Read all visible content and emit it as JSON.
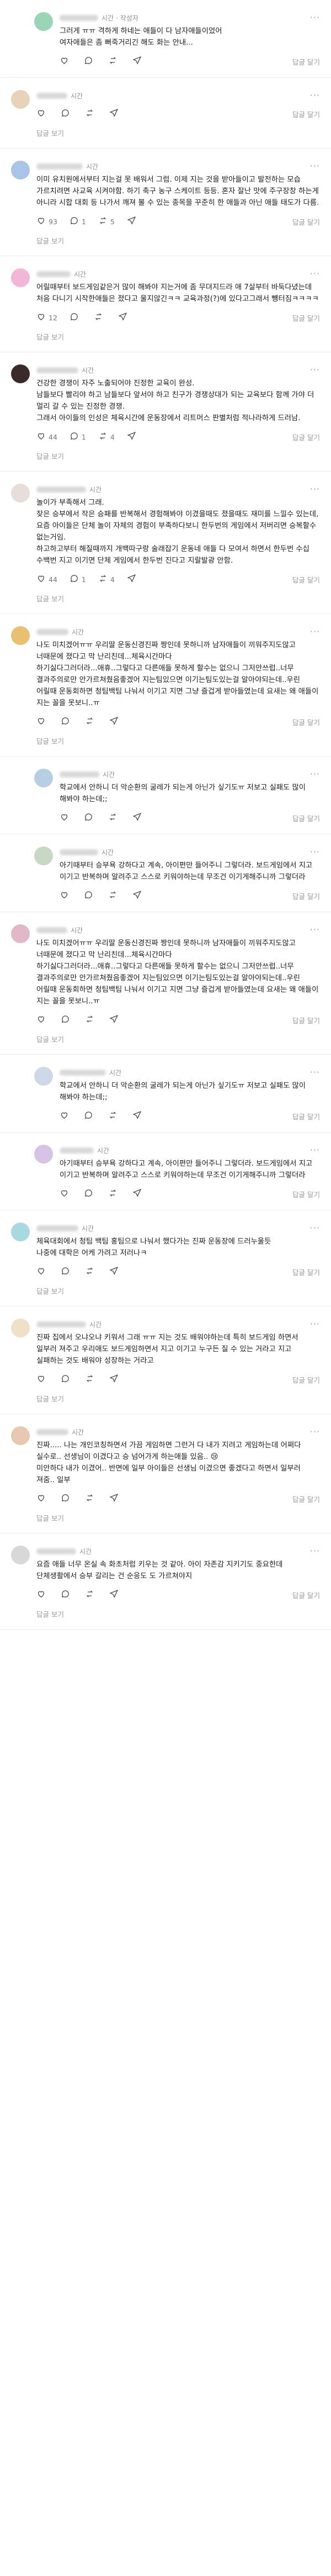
{
  "labels": {
    "view_replies": "답글 보기",
    "reply": "답글 달기",
    "author_badge": "작성자",
    "more": "···"
  },
  "colors": {
    "like_red": "#e5484d",
    "text": "#1b1b1b",
    "muted": "#8e8e8e"
  },
  "comments": [
    {
      "time": "시간",
      "author": true,
      "text": "그러게 ㅠㅠ 격하게 하네는 애들이 다 남자애들이었어\n여자애들은 좀 뻐죽거리긴 해도 화는 안내...",
      "likes": "",
      "views": "",
      "shares": "",
      "avatar": "#9bd5b8",
      "nested": true,
      "show_view": false
    },
    {
      "time": "시간",
      "author": false,
      "text": "",
      "likes": "",
      "views": "",
      "shares": "",
      "avatar": "#e7d3b8",
      "nested": false,
      "show_view": true,
      "short": true
    },
    {
      "time": "시간",
      "author": false,
      "text": "이미 유치원에서부터 지는걸 못 배워서 그럼. 이제 지는 것을 받아들이고 발전하는 모습 가르치려면 사교육 시켜야함. 하기 축구 농구 스케이트 등등. 혼자 잘난 맛에 주구장창 하는게 아니라 시합 대회 등 나가서 깨져 볼 수 있는 종목을 꾸준히 한 애들과 아닌 애들 태도가 다름.",
      "likes": "93",
      "views": "1",
      "shares": "5",
      "avatar": "#a9c4e6",
      "nested": false,
      "show_view": true
    },
    {
      "time": "시간",
      "author": false,
      "text": "어릴때부터 보드게임같은거 많이 해봐야 지는거에 좀 무뎌지드라 애 7살부터 바둑다녔는데 처음 다니기 시작한애들은 졌다고 울지않긴ㅋㅋ 교육과정(?)에 있다고그래서 뻉터짐ㅋㅋㅋㅋ",
      "likes": "12",
      "views": "",
      "shares": "",
      "avatar": "#f3b6d6",
      "nested": false,
      "show_view": true
    },
    {
      "time": "시간",
      "author": false,
      "text": "건강한 경쟁이 자주 노출되어야 진정한 교육이 완성.\n남들보다 빨리야 하고 남들보다 앞서야 하고 친구가 경쟁상대가 되는 교육보다 함께 가야 더 멀리 갈 수 있는 진정한 경쟁.\n그래서 아이들의 인성은 체육시간에 운동장에서 리트머스 판별처럼 적나라하게 드러남.",
      "likes": "44",
      "views": "1",
      "shares": "4",
      "avatar": "#3a2a2a",
      "nested": false,
      "show_view": true
    },
    {
      "time": "시간",
      "author": false,
      "text": "놀이가 부족해서 그래.\n잦은 승부에서 작은 승패를 반복해서 경험해봐야 이겼을때도 졌을때도 재미를 느낄수 있는데, 요즘 아이들은 단체 놀이 자체의 경험이 부족하다보니 한두번의 게임에서 저버리면 승복할수 없는거임.\n하고하고부터 해질때까지 개백따구랑 술래잡기 운동네 애들 다 모여서 하면서 한두번 수십 수백번 지고 이기면 단체 게임에서 한두번 진다고 지랄발광 안함.",
      "likes": "44",
      "views": "1",
      "shares": "4",
      "avatar": "#e8ddd8",
      "nested": false,
      "show_view": true
    },
    {
      "time": "시간",
      "author": false,
      "text": "나도 미치겠어ㅠㅠ 우리딸 운동신경진짜 짱인데 못하니까 남자애들이 끼워주지도않고 너때문에 졌다고 막 난리친데...체육시간마다\n하기싫다그러더라...애휴..그렇다고 다른애들 못하게 할수는 없으니 그저안쓰럽..너무 결과주의로만 안가르쳐줬음좋겠어 지는팀있으면 이기는팀도있는걸 알아야되는데..우린 어릴때 운동회하면 청팀백팀 나눠서 이기고 지면 그냥 즐겁게 받아들였는데 요새는 왜 애들이 지는 꼴을 못보니..ㅠ",
      "likes": "",
      "views": "",
      "shares": "",
      "avatar": "#e9c070",
      "nested": false,
      "show_view": true
    },
    {
      "time": "시간",
      "author": false,
      "text": "학교에서 안하니 더 악순환의 굴레가 되는게 아닌가 싶기도ㅠ 저보고 실패도 많이 해봐야 하는데;;",
      "likes": "",
      "views": "",
      "shares": "",
      "avatar": "#b7cfe3",
      "nested": true,
      "show_view": false
    },
    {
      "time": "시간",
      "author": false,
      "text": "아기때부터 승부욕 강하다고 계속, 아이편만 들어주니 그렇더라. 보드게임에서 지고 이기고 반복하며 알려주고 스스로 키워야하는데 무조건 이기게해주니까 그렇더라",
      "likes": "",
      "views": "",
      "shares": "",
      "avatar": "#c7d9c3",
      "nested": true,
      "show_view": false
    },
    {
      "time": "시간",
      "author": false,
      "text": "나도 미치겠어ㅠㅠ 우리딸 운동신경진짜 짱인데 못하니까 남자애들이 끼워주지도않고 너때문에 졌다고 막 난리친데...체육시간마다\n하기싫다그러더라...애휴..그렇다고 다른애들 못하게 할수는 없으니 그저안쓰럽..너무 결과주의로만 안가르쳐줬음좋겠어 지는팀있으면 이기는팀도있는걸 알아야되는데..우린 어릴때 운동회하면 청팀백팀 나눠서 이기고 지면 그냥 즐겁게 받아들였는데 요새는 왜 애들이 지는 꼴을 못보니..ㅠ",
      "likes": "",
      "views": "",
      "shares": "",
      "avatar": "#e0b8c8",
      "nested": false,
      "show_view": true
    },
    {
      "time": "시간",
      "author": false,
      "text": "학교에서 안하니 더 악순환의 굴레가 되는게 아닌가 싶기도ㅠ 저보고 실패도 많이 해봐야 하는데;;",
      "likes": "",
      "views": "",
      "shares": "",
      "avatar": "#cfd8e8",
      "nested": true,
      "show_view": false
    },
    {
      "time": "시간",
      "author": false,
      "text": "아기때부터 승부욕 강하다고 계속, 아이편만 들어주니 그렇더라. 보드게임에서 지고 이기고 반복하며 알려주고 스스로 키워야하는데 무조건 이기게해주니까 그렇더라",
      "likes": "",
      "views": "",
      "shares": "",
      "avatar": "#d7c3e6",
      "nested": true,
      "show_view": false
    },
    {
      "time": "시간",
      "author": false,
      "text": "체육대회에서 청팀 백팀 홍팀으로 나눠서 했다가는 진짜 운동장에 드러누울듯\n나중에 대학은 어케 가려고 저러나ㅋ",
      "likes": "",
      "views": "",
      "shares": "",
      "avatar": "#a8d8e0",
      "nested": false,
      "show_view": true
    },
    {
      "time": "시간",
      "author": false,
      "text": "진짜 집에서 오냐오냐 키워서 그래 ㅠㅠ 지는 것도 배워야하는데 특히 보드게임 하면서 일부러 져주고 우리애도 보드게임하면서 지고 이기고 누구든 질 수 있는 거라고 지고 실패하는 것도 배워야 성장하는 거라고",
      "likes": "",
      "views": "",
      "shares": "",
      "avatar": "#f0e0c8",
      "nested": false,
      "show_view": true
    },
    {
      "time": "시간",
      "author": false,
      "text": "진짜..... 나는 개인코칭하면서 가끔 게임하면 그런거 다 내가 지려고 게임하는데 어쩌다 실수로.. 선생님이 이겼다고 승 넘어가게 하는애들 있음.. 😢\n미안하다 내가 이겼어.. 반면에 일부 아이들은 선생님 이겼으면 좋겠다고 하면서 일부러 져줌.. 일부",
      "likes": "",
      "views": "",
      "shares": "",
      "avatar": "#e8c8b0",
      "nested": false,
      "show_view": true
    },
    {
      "time": "시간",
      "author": false,
      "text": "요즘 애들 너무 온실 속 화초처럼 키우는 것 같아. 아이 자존감 지키기도 중요한데 단체생활에서 승부 갈리는 건 순응도 도 가르쳐야지",
      "likes": "",
      "views": "",
      "shares": "",
      "avatar": "#d8d8d8",
      "nested": false,
      "show_view": true
    }
  ]
}
